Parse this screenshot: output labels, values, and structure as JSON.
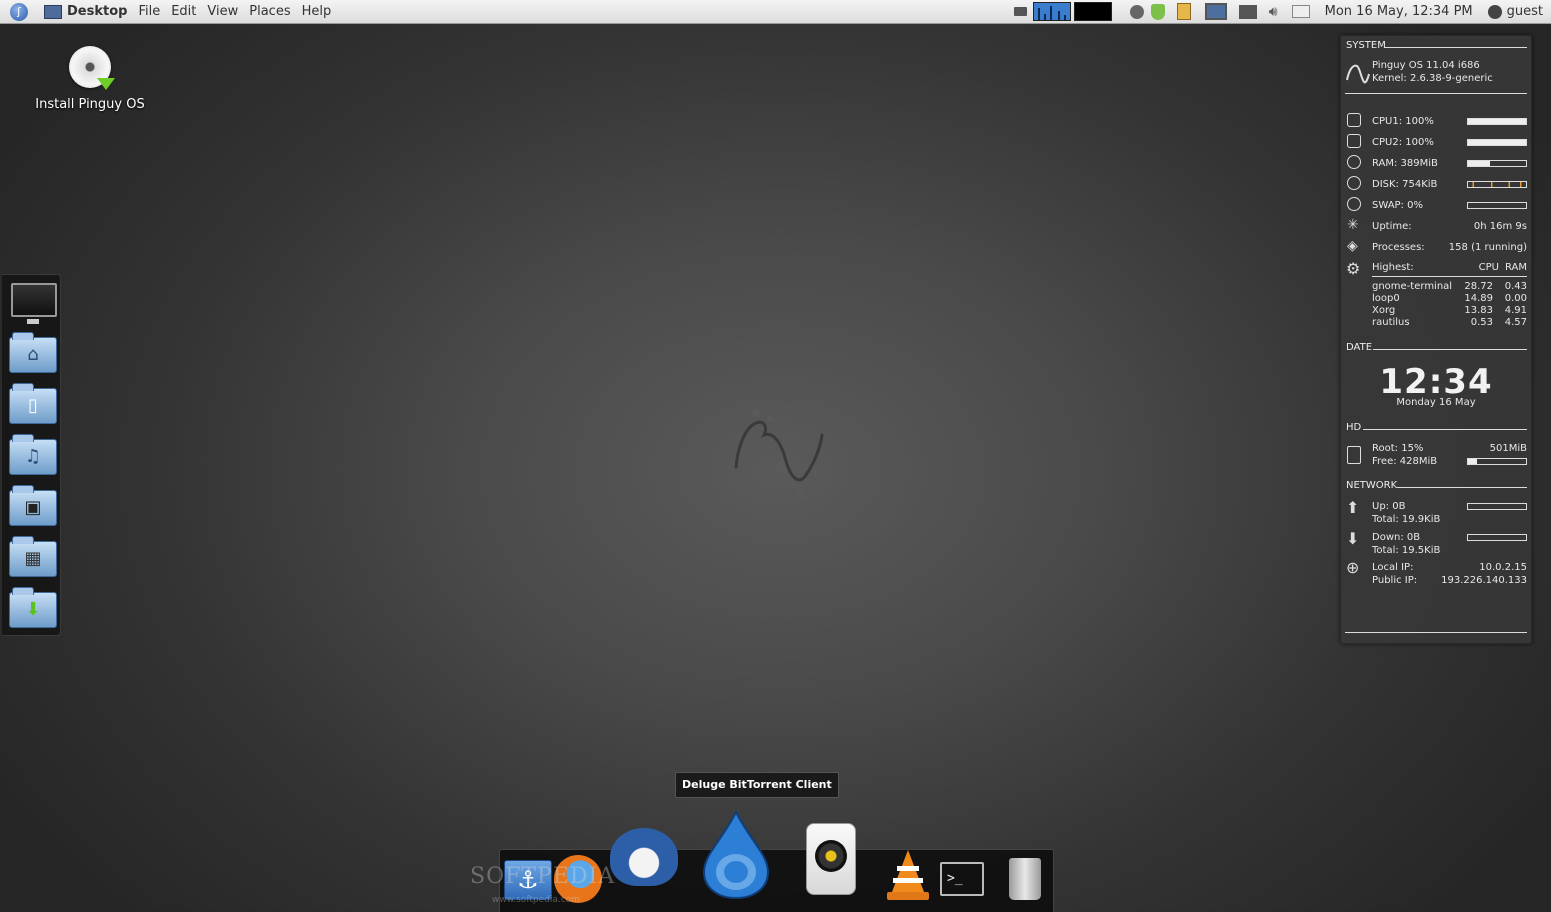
{
  "top_panel": {
    "app_name": "Desktop",
    "menus": [
      "File",
      "Edit",
      "View",
      "Places",
      "Help"
    ],
    "clock": "Mon 16 May, 12:34 PM",
    "user": "guest"
  },
  "desktop": {
    "icon_label": "Install Pinguy OS"
  },
  "conky": {
    "system_title": "SYSTEM",
    "os": "Pinguy OS 11.04 i686",
    "kernel": "Kernel: 2.6.38-9-generic",
    "cpu1": "CPU1: 100%",
    "cpu1_level": 1.0,
    "cpu2": "CPU2: 100%",
    "cpu2_level": 1.0,
    "ram": "RAM: 389MiB",
    "ram_level": 0.38,
    "disk": "DISK: 754KiB",
    "swap": "SWAP: 0%",
    "swap_level": 0.0,
    "uptime_label": "Uptime:",
    "uptime_value": "0h 16m 9s",
    "processes_label": "Processes:",
    "processes_value": "158 (1 running)",
    "highest_label": "Highest:",
    "col_cpu": "CPU",
    "col_ram": "RAM",
    "top_processes": [
      {
        "name": "gnome-terminal",
        "cpu": "28.72",
        "ram": "0.43"
      },
      {
        "name": "loop0",
        "cpu": "14.89",
        "ram": "0.00"
      },
      {
        "name": "Xorg",
        "cpu": "13.83",
        "ram": "4.91"
      },
      {
        "name": "rautilus",
        "cpu": "0.53",
        "ram": "4.57"
      }
    ],
    "date_title": "DATE",
    "time": "12:34",
    "date": "Monday 16 May",
    "hd_title": "HD",
    "root": "Root: 15%",
    "root_size": "501MiB",
    "free": "Free: 428MiB",
    "root_level": 0.15,
    "network_title": "NETWORK",
    "up": "Up: 0B",
    "up_total": "Total: 19.9KiB",
    "down": "Down: 0B",
    "down_total": "Total: 19.5KiB",
    "local_ip_label": "Local IP:",
    "local_ip": "10.0.2.15",
    "public_ip_label": "Public IP:",
    "public_ip": "193.226.140.133"
  },
  "dock": {
    "tooltip": "Deluge BitTorrent Client",
    "watermark": "SOFTPEDIA",
    "watermark_url": "www.softpedia.com"
  },
  "colors": {
    "firefox": "#e8751a",
    "deluge": "#2d7fd6",
    "vlc": "#f08a1c"
  }
}
